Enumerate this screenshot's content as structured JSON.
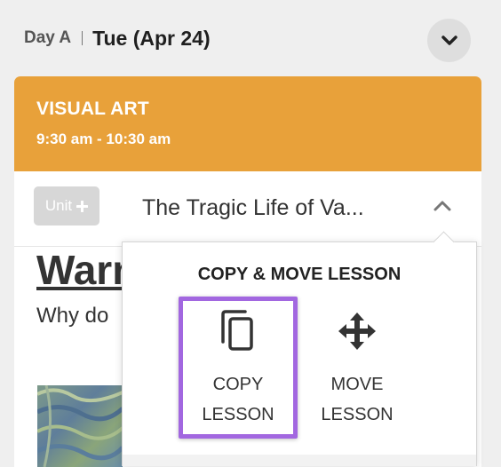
{
  "header": {
    "day": "Day A",
    "date": "Tue (Apr 24)"
  },
  "card": {
    "subject": "VISUAL ART",
    "time": "9:30 am - 10:30 am",
    "unit_label": "Unit",
    "lesson_title": "The Tragic Life of Va...",
    "content_heading": "Warm",
    "content_text": "Why do"
  },
  "popup": {
    "title": "COPY & MOVE LESSON",
    "copy_line1": "COPY",
    "copy_line2": "LESSON",
    "move_line1": "MOVE",
    "move_line2": "LESSON"
  },
  "colors": {
    "header_bg": "#e8a13a",
    "highlight": "#a267e0",
    "unit_bg": "#d7d7d7"
  },
  "icons": [
    "chevron-down-icon",
    "plus-icon",
    "chevron-up-icon",
    "copy-icon",
    "move-icon"
  ]
}
